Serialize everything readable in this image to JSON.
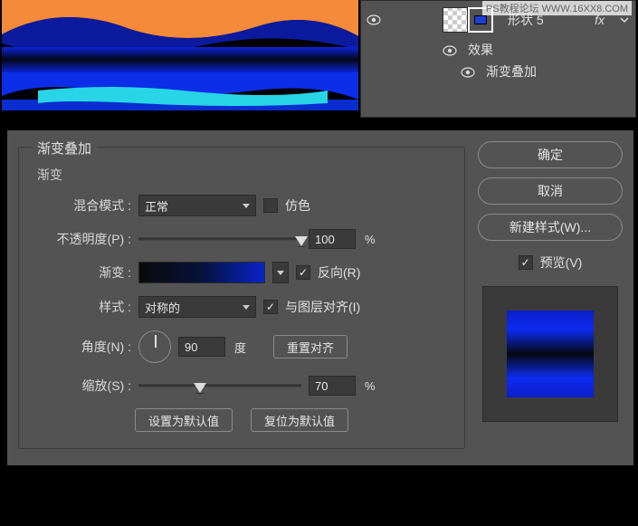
{
  "watermark": "PS教程论坛 WWW.16XX8.COM",
  "layers": {
    "layer_name": "形状 5",
    "fx": "fx",
    "effects_label": "效果",
    "gradient_overlay_label": "渐变叠加"
  },
  "dialog": {
    "group_title": "渐变叠加",
    "sub_title": "渐变",
    "blend_mode_label": "混合模式 :",
    "blend_mode_value": "正常",
    "dither_label": "仿色",
    "opacity_label": "不透明度(P) :",
    "opacity_value": "100",
    "opacity_unit": "%",
    "gradient_label": "渐变 :",
    "reverse_label": "反向(R)",
    "style_label": "样式 :",
    "style_value": "对称的",
    "align_label": "与图层对齐(I)",
    "angle_label": "角度(N) :",
    "angle_value": "90",
    "angle_unit": "度",
    "reset_align": "重置对齐",
    "scale_label": "缩放(S) :",
    "scale_value": "70",
    "scale_unit": "%",
    "set_default": "设置为默认值",
    "reset_default": "复位为默认值"
  },
  "buttons": {
    "ok": "确定",
    "cancel": "取消",
    "new_style": "新建样式(W)...",
    "preview": "预览(V)"
  }
}
